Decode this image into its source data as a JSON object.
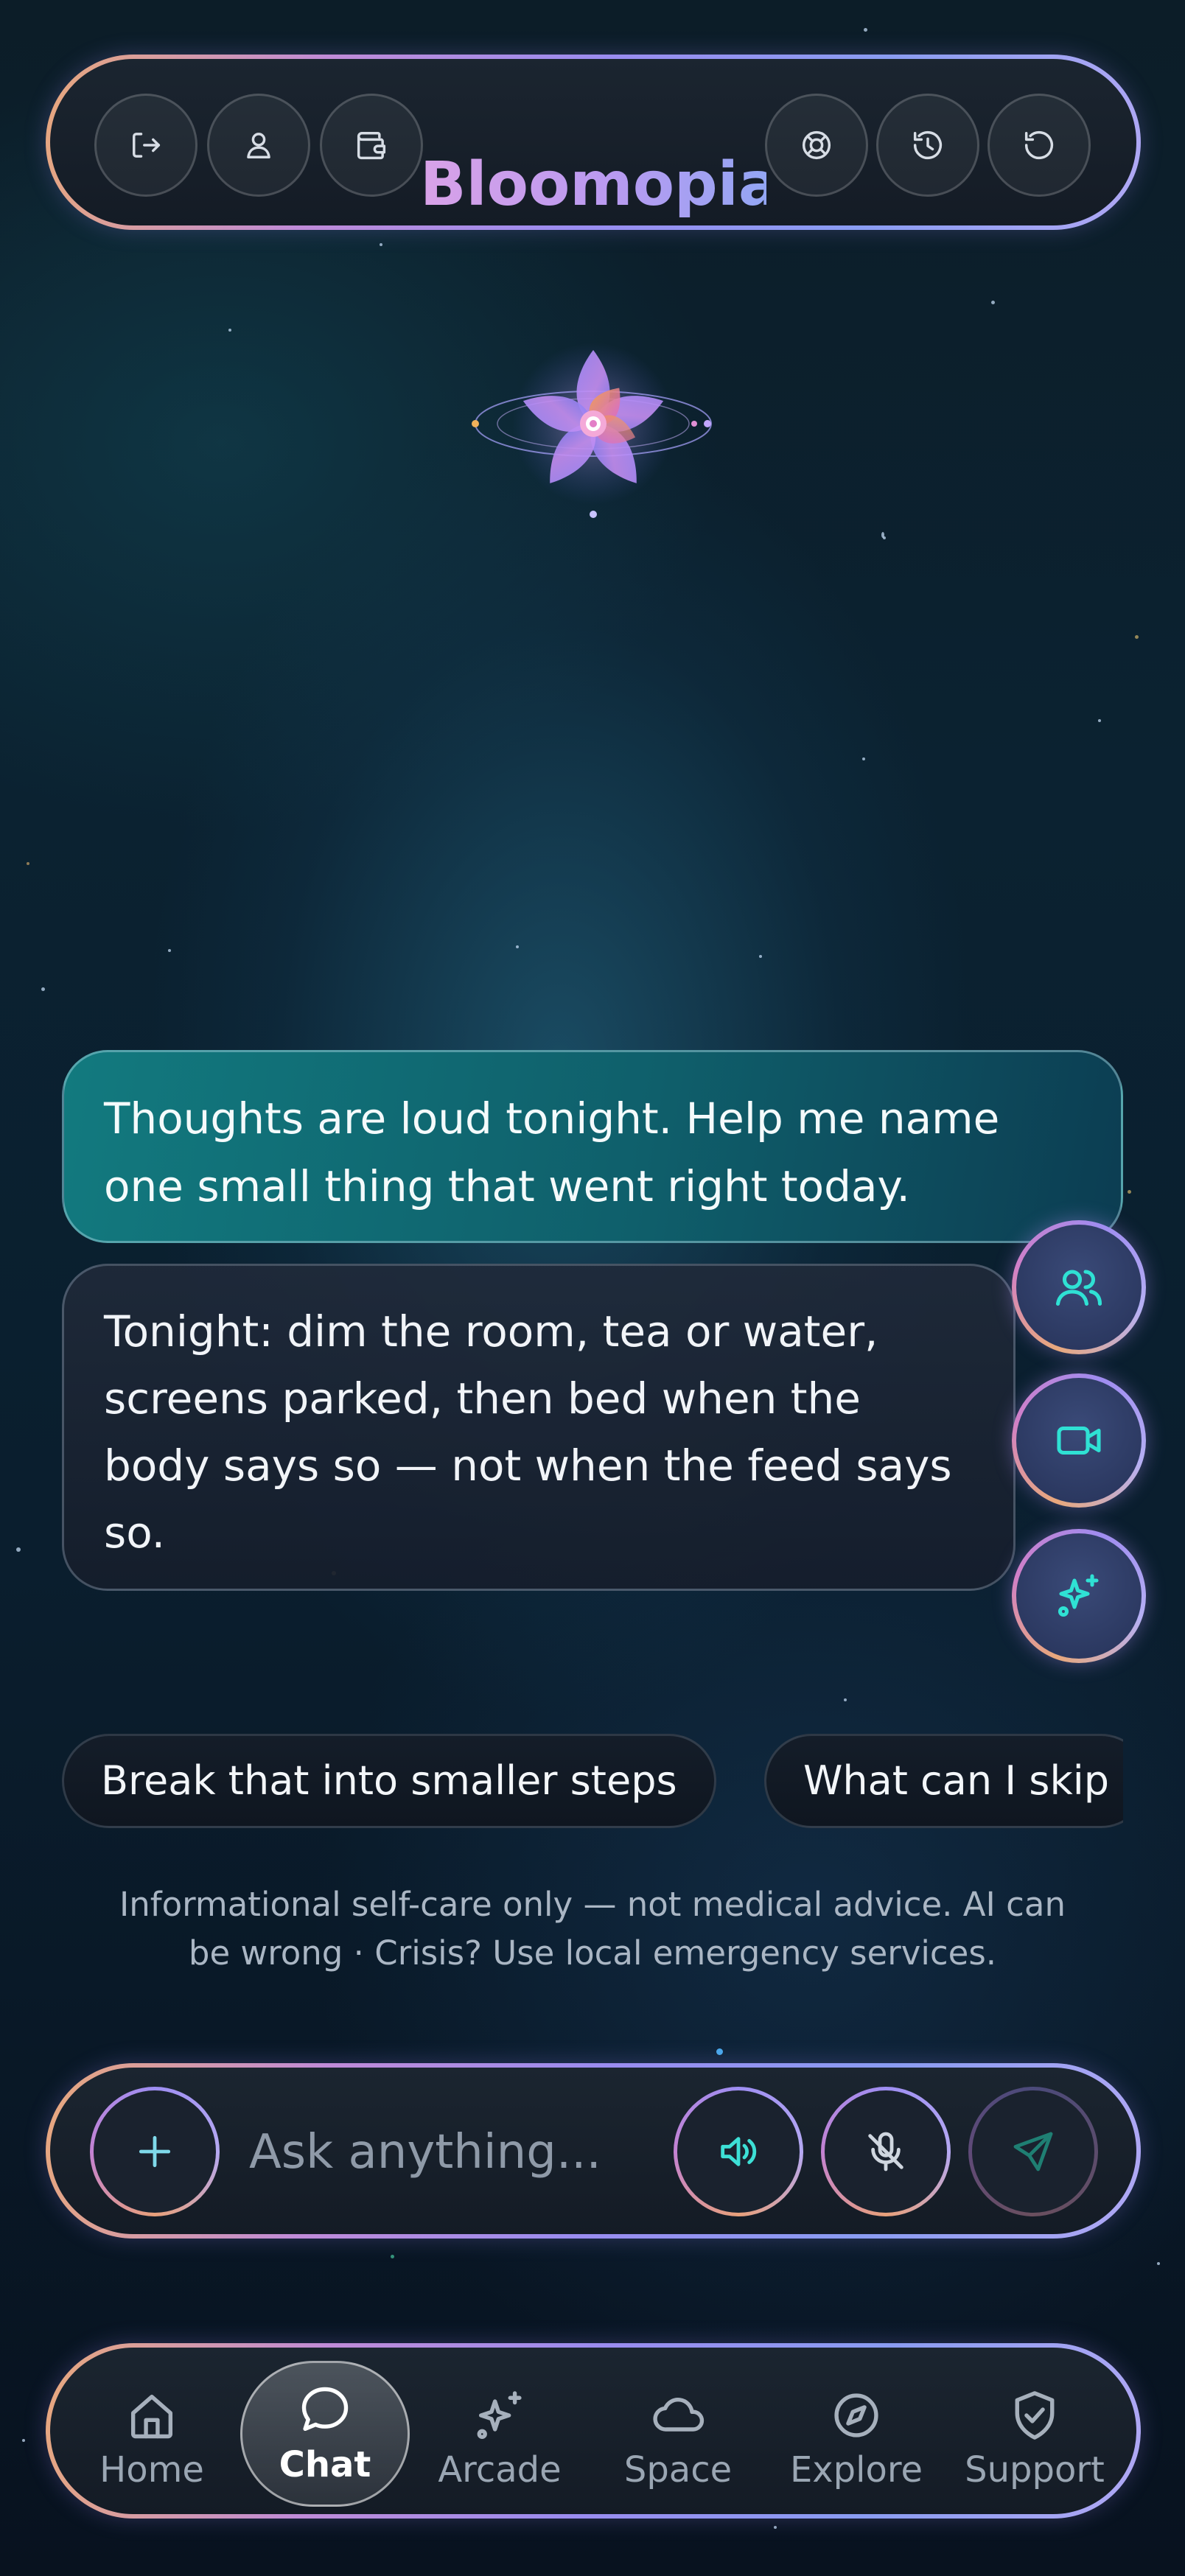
{
  "app": {
    "title": "Bloomopia"
  },
  "header": {
    "left_icons": [
      "logout-icon",
      "profile-icon",
      "wallet-icon"
    ],
    "right_icons": [
      "help-lifebuoy-icon",
      "history-icon",
      "reset-icon"
    ]
  },
  "chat": {
    "messages": [
      {
        "role": "user",
        "text": "Thoughts are loud tonight. Help me name one small thing that went right today."
      },
      {
        "role": "assistant",
        "text": "Tonight: dim the room, tea or water, screens parked, then bed when the body says so — not when the feed says so."
      }
    ],
    "floating_actions": [
      "people-icon",
      "video-icon",
      "sparkles-icon"
    ],
    "suggestions": [
      "Break that into smaller steps",
      "What can I skip"
    ],
    "disclaimer": "Informational self-care only — not medical advice. AI can be wrong · Crisis? Use local emergency services."
  },
  "composer": {
    "placeholder": "Ask anything...",
    "buttons": [
      "plus-icon",
      "speaker-icon",
      "mic-off-icon",
      "send-icon"
    ]
  },
  "nav": {
    "items": [
      {
        "label": "Home",
        "icon": "home-icon"
      },
      {
        "label": "Chat",
        "icon": "chat-icon",
        "active": true
      },
      {
        "label": "Arcade",
        "icon": "sparkle-icon"
      },
      {
        "label": "Space",
        "icon": "cloud-icon"
      },
      {
        "label": "Explore",
        "icon": "compass-icon"
      },
      {
        "label": "Support",
        "icon": "shield-icon"
      }
    ]
  },
  "colors": {
    "accent_teal": "#2fe1d4",
    "title_gradient_start": "#d9a2e8",
    "title_gradient_end": "#93a6f4",
    "user_bubble": "#127a7f"
  }
}
